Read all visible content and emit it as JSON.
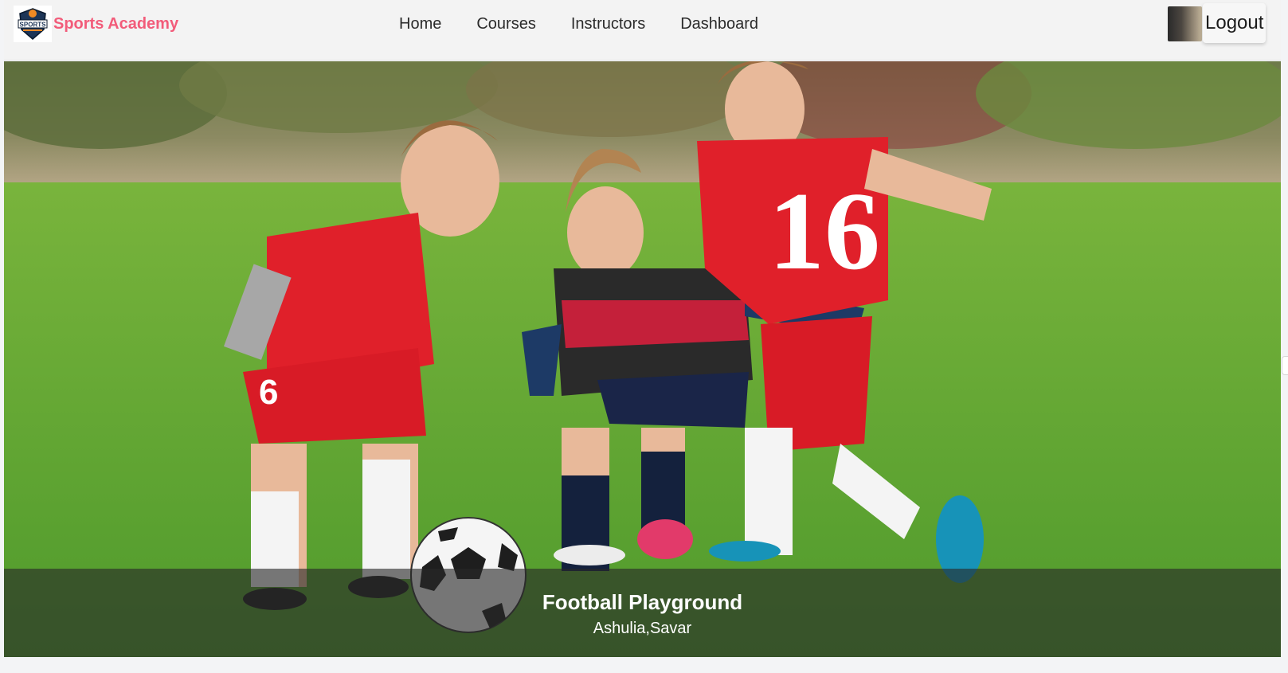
{
  "brand": {
    "name": "Sports Academy",
    "logo_icon": "sports-shield-logo",
    "logo_text": "SPORTS"
  },
  "nav": {
    "items": [
      {
        "label": "Home"
      },
      {
        "label": "Courses"
      },
      {
        "label": "Instructors"
      },
      {
        "label": "Dashboard"
      }
    ]
  },
  "user": {
    "avatar_icon": "user-avatar-photo",
    "logout_label": "Logout"
  },
  "hero": {
    "title": "Football Playground",
    "subtitle": "Ashulia,Savar",
    "jersey_number": "16",
    "shorts_number": "6"
  },
  "colors": {
    "brand_accent": "#f25c7a",
    "navbar_bg": "#f3f3f3",
    "caption_bg": "rgba(40,40,40,0.62)",
    "grass": "#5aa52e"
  }
}
